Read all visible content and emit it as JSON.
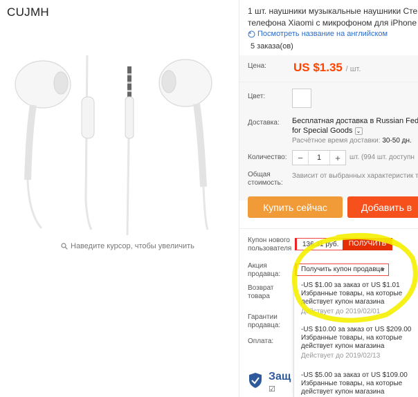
{
  "store": {
    "brand": "CUJMH"
  },
  "gallery": {
    "zoom_hint": "Наведите курсор, чтобы увеличить"
  },
  "product": {
    "title_line1": "1 шт. наушники музыкальные наушники Сте",
    "title_line2": "телефона Xiaomi с микрофоном для iPhone 5",
    "translate_link": "Посмотреть название на английском",
    "orders": "5 заказа(ов)"
  },
  "labels": {
    "price": "Цена:",
    "color": "Цвет:",
    "delivery": "Доставка:",
    "quantity": "Количество:",
    "total_l1": "Общая",
    "total_l2": "стоимость:",
    "new_user_coupon_l1": "Купон нового",
    "new_user_coupon_l2": "пользователя",
    "seller_promo_l1": "Акция",
    "seller_promo_l2": "продавца:",
    "return_l1": "Возврат",
    "return_l2": "товара",
    "guarantee_l1": "Гарантии",
    "guarantee_l2": "продавца:",
    "payment": "Оплата:"
  },
  "price": {
    "value": "US $1.35",
    "unit": "/ шт."
  },
  "shipping": {
    "line1": "Бесплатная доставка в Russian Feder",
    "line2": "for Special Goods",
    "est_label": "Расчётное время доставки:",
    "est_value": "30-50 дн."
  },
  "quantity": {
    "minus": "−",
    "value": "1",
    "plus": "+",
    "note": "шт. (994 шт. доступн"
  },
  "total": {
    "note": "Зависит от выбранных характеристик т"
  },
  "buttons": {
    "buy_now": "Купить сейчас",
    "add_to_cart": "Добавить в"
  },
  "coupons": {
    "new_user_amount": "136,31 руб.",
    "get": "ПОЛУЧИТЬ",
    "seller_select": "Получить купон продавца",
    "list": [
      {
        "title": "-US $1.00 за заказ от US $1.01",
        "desc1": "Избранные товары, на которые",
        "desc2": "действует купон магазина",
        "expiry": "Действует до 2019/02/01"
      },
      {
        "title": "-US $10.00 за заказ от US $209.00",
        "desc1": "Избранные товары, на которые",
        "desc2": "действует купон магазина",
        "expiry": "Действует до 2019/02/13"
      },
      {
        "title": "-US $5.00 за заказ от US $109.00",
        "desc1": "Избранные товары, на которые",
        "desc2": "действует купон магазина",
        "expiry": ""
      }
    ]
  },
  "protection": {
    "title": "Защ",
    "check": "☑"
  },
  "colors": {
    "accent_orange": "#f19b38",
    "cart_orange": "#f6511d",
    "price_red": "#ff4400",
    "coupon_red": "#e62e04",
    "highlight_yellow": "#f5f000"
  }
}
